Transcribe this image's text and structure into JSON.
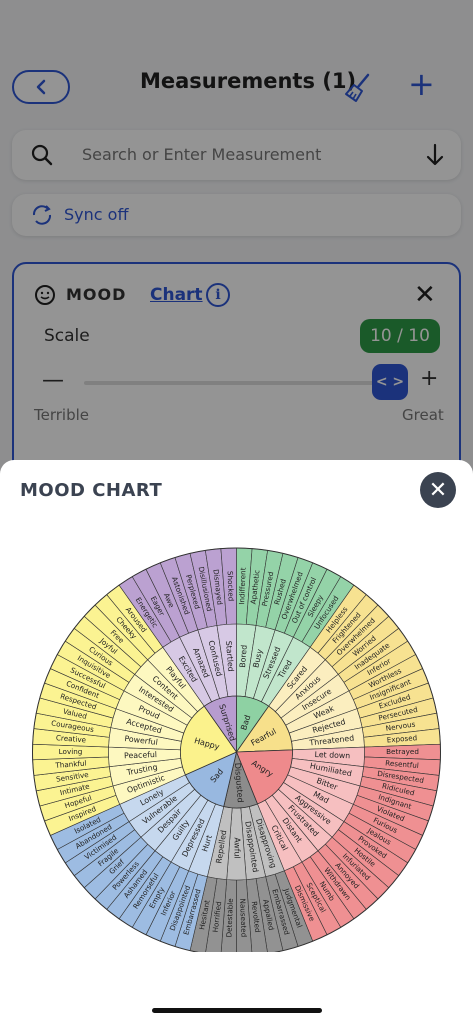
{
  "header": {
    "title": "Measurements (1)"
  },
  "search": {
    "placeholder": "Search or Enter Measurement"
  },
  "sync": {
    "label": "Sync off"
  },
  "card": {
    "name": "MOOD",
    "chart_link": "Chart",
    "info": "i",
    "scale_label": "Scale",
    "scale_value": "10 / 10",
    "min_label": "Terrible",
    "max_label": "Great",
    "slider_fraction": 1.0
  },
  "sheet": {
    "title": "MOOD CHART"
  },
  "colors": {
    "accent": "#2f57d4",
    "good": "#2e9b47",
    "dark": "#3b4351"
  },
  "wheel": {
    "core": [
      {
        "name": "Bad",
        "color": "#8ed1a3"
      },
      {
        "name": "Fearful",
        "color": "#f7e08b"
      },
      {
        "name": "Angry",
        "color": "#ee8a8c"
      },
      {
        "name": "Disgusted",
        "color": "#8c8c8c"
      },
      {
        "name": "Sad",
        "color": "#98b8e0"
      },
      {
        "name": "Happy",
        "color": "#fbf28c"
      },
      {
        "name": "Surprised",
        "color": "#b79ccf"
      }
    ],
    "mid": [
      {
        "name": "Bored",
        "core": 0
      },
      {
        "name": "Busy",
        "core": 0
      },
      {
        "name": "Stressed",
        "core": 0
      },
      {
        "name": "Tired",
        "core": 0
      },
      {
        "name": "Scared",
        "core": 1
      },
      {
        "name": "Anxious",
        "core": 1
      },
      {
        "name": "Insecure",
        "core": 1
      },
      {
        "name": "Weak",
        "core": 1
      },
      {
        "name": "Rejected",
        "core": 1
      },
      {
        "name": "Threatened",
        "core": 1
      },
      {
        "name": "Let down",
        "core": 2
      },
      {
        "name": "Humiliated",
        "core": 2
      },
      {
        "name": "Bitter",
        "core": 2
      },
      {
        "name": "Mad",
        "core": 2
      },
      {
        "name": "Aggressive",
        "core": 2
      },
      {
        "name": "Frustrated",
        "core": 2
      },
      {
        "name": "Distant",
        "core": 2
      },
      {
        "name": "Critical",
        "core": 2
      },
      {
        "name": "Disapproving",
        "core": 3
      },
      {
        "name": "Disappointed",
        "core": 3
      },
      {
        "name": "Awful",
        "core": 3
      },
      {
        "name": "Repelled",
        "core": 3
      },
      {
        "name": "Hurt",
        "core": 4
      },
      {
        "name": "Depressed",
        "core": 4
      },
      {
        "name": "Guilty",
        "core": 4
      },
      {
        "name": "Despair",
        "core": 4
      },
      {
        "name": "Vulnerable",
        "core": 4
      },
      {
        "name": "Lonely",
        "core": 4
      },
      {
        "name": "Optimistic",
        "core": 5
      },
      {
        "name": "Trusting",
        "core": 5
      },
      {
        "name": "Peaceful",
        "core": 5
      },
      {
        "name": "Powerful",
        "core": 5
      },
      {
        "name": "Accepted",
        "core": 5
      },
      {
        "name": "Proud",
        "core": 5
      },
      {
        "name": "Interested",
        "core": 5
      },
      {
        "name": "Content",
        "core": 5
      },
      {
        "name": "Playful",
        "core": 5
      },
      {
        "name": "Excited",
        "core": 6
      },
      {
        "name": "Amazed",
        "core": 6
      },
      {
        "name": "Confused",
        "core": 6
      },
      {
        "name": "Startled",
        "core": 6
      }
    ],
    "outer": [
      "Indifferent",
      "Apathetic",
      "Pressured",
      "Rushed",
      "Overwhelmed",
      "Out of control",
      "Sleepy",
      "Unfocused",
      "Helpless",
      "Frightened",
      "Overwhelmed",
      "Worried",
      "Inadequate",
      "Inferior",
      "Worthless",
      "Insignificant",
      "Excluded",
      "Persecuted",
      "Nervous",
      "Exposed",
      "Betrayed",
      "Resentful",
      "Disrespected",
      "Ridiculed",
      "Indignant",
      "Violated",
      "Furious",
      "Jealous",
      "Provoked",
      "Hostile",
      "Infuriated",
      "Annoyed",
      "Withdrawn",
      "Numb",
      "Sceptical",
      "Dismissive",
      "Judgmental",
      "Embarrassed",
      "Appalled",
      "Revolted",
      "Nauseated",
      "Detestable",
      "Horrified",
      "Hesitant",
      "Embarrassed",
      "Disappointed",
      "Inferior",
      "Empty",
      "Remorseful",
      "Ashamed",
      "Powerless",
      "Grief",
      "Fragile",
      "Victimised",
      "Abandoned",
      "Isolated",
      "Inspired",
      "Hopeful",
      "Intimate",
      "Sensitive",
      "Thankful",
      "Loving",
      "Creative",
      "Courageous",
      "Valued",
      "Respected",
      "Confident",
      "Successful",
      "Inquisitive",
      "Curious",
      "Joyful",
      "Free",
      "Cheeky",
      "Aroused",
      "Energetic",
      "Eager",
      "Awe",
      "Astonished",
      "Perplexed",
      "Disillusioned",
      "Dismayed",
      "Shocked"
    ],
    "outer_core": [
      0,
      0,
      0,
      0,
      0,
      0,
      0,
      0,
      1,
      1,
      1,
      1,
      1,
      1,
      1,
      1,
      1,
      1,
      1,
      1,
      2,
      2,
      2,
      2,
      2,
      2,
      2,
      2,
      2,
      2,
      2,
      2,
      2,
      2,
      2,
      2,
      3,
      3,
      3,
      3,
      3,
      3,
      3,
      3,
      4,
      4,
      4,
      4,
      4,
      4,
      4,
      4,
      4,
      4,
      4,
      4,
      5,
      5,
      5,
      5,
      5,
      5,
      5,
      5,
      5,
      5,
      5,
      5,
      5,
      5,
      5,
      5,
      5,
      5,
      6,
      6,
      6,
      6,
      6,
      6,
      6,
      6
    ]
  }
}
